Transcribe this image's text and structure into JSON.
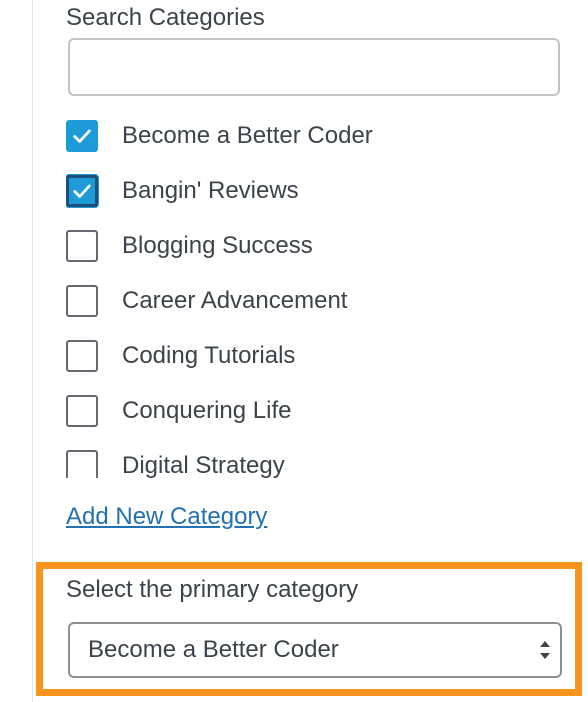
{
  "search": {
    "label": "Search Categories",
    "value": "",
    "placeholder": ""
  },
  "categories": [
    {
      "label": "Become a Better Coder",
      "checked": true
    },
    {
      "label": "Bangin' Reviews",
      "checked": true
    },
    {
      "label": "Blogging Success",
      "checked": false
    },
    {
      "label": "Career Advancement",
      "checked": false
    },
    {
      "label": "Coding Tutorials",
      "checked": false
    },
    {
      "label": "Conquering Life",
      "checked": false
    },
    {
      "label": "Digital Strategy",
      "checked": false
    }
  ],
  "add_new_link": "Add New Category",
  "primary": {
    "label": "Select the primary category",
    "selected": "Become a Better Coder"
  },
  "colors": {
    "checkbox_checked": "#1f9ad8",
    "highlight_border": "#f7941d",
    "link": "#2271b1"
  }
}
